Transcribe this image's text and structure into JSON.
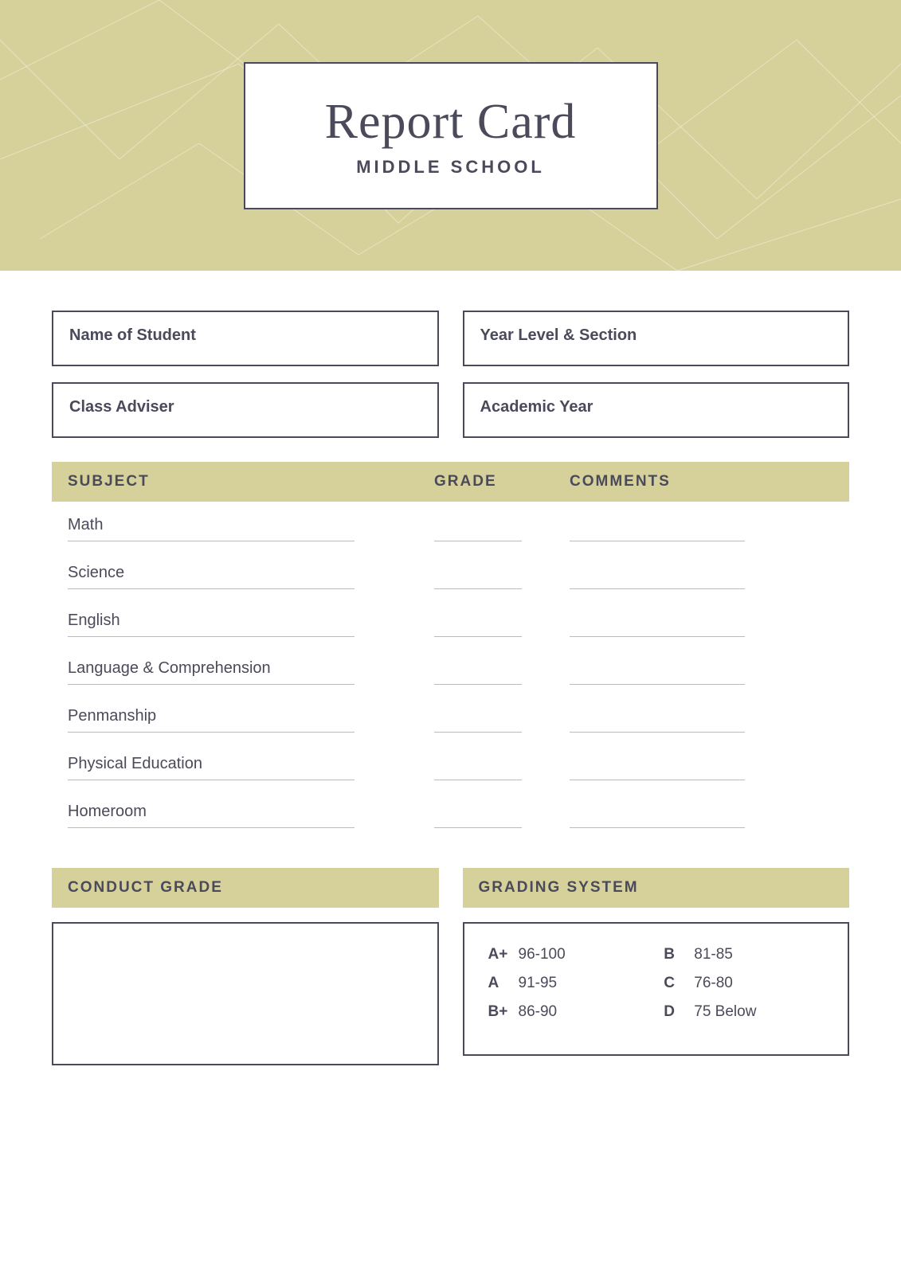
{
  "header": {
    "title": "Report Card",
    "subtitle": "MIDDLE SCHOOL"
  },
  "fields": {
    "name_of_student": "Name of Student",
    "year_level_section": "Year Level & Section",
    "class_adviser": "Class Adviser",
    "academic_year": "Academic Year"
  },
  "table": {
    "columns": {
      "subject": "SUBJECT",
      "grade": "GRADE",
      "comments": "COMMENTS"
    },
    "subjects": [
      {
        "name": "Math"
      },
      {
        "name": "Science"
      },
      {
        "name": "English"
      },
      {
        "name": "Language & Comprehension"
      },
      {
        "name": "Penmanship"
      },
      {
        "name": "Physical Education"
      },
      {
        "name": "Homeroom"
      }
    ]
  },
  "bottom": {
    "conduct_grade_label": "CONDUCT GRADE",
    "grading_system_label": "GRADING SYSTEM",
    "grades": [
      {
        "letter": "A+",
        "range": "96-100"
      },
      {
        "letter": "B",
        "range": "81-85"
      },
      {
        "letter": "A",
        "range": "91-95"
      },
      {
        "letter": "C",
        "range": "76-80"
      },
      {
        "letter": "B+",
        "range": "86-90"
      },
      {
        "letter": "D",
        "range": "75 Below"
      }
    ]
  }
}
